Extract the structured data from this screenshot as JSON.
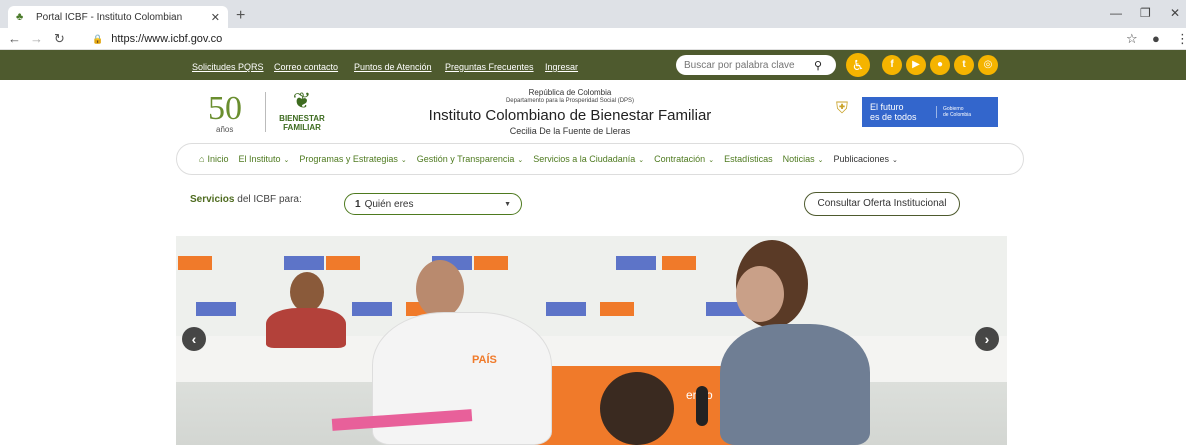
{
  "browser": {
    "tab_title": "Portal ICBF - Instituto Colombian",
    "url": "https://www.icbf.gov.co"
  },
  "topbar": {
    "links": [
      "Solicitudes PQRS",
      "Correo contacto",
      "Puntos de Atención",
      "Preguntas Frecuentes",
      "Ingresar"
    ],
    "search_placeholder": "Buscar por palabra clave"
  },
  "header": {
    "logo_number": "50",
    "logo_years": "años",
    "logo_bf_line1": "BIENESTAR",
    "logo_bf_line2": "FAMILIAR",
    "republic": "República de Colombia",
    "department": "Departamento para la Prosperidad Social (DPS)",
    "institute": "Instituto Colombiano de Bienestar Familiar",
    "director": "Cecilia De la Fuente de Lleras",
    "gov_slogan_1": "El futuro",
    "gov_slogan_2": "es de todos",
    "gov_name_1": "Gobierno",
    "gov_name_2": "de Colombia"
  },
  "nav": {
    "items": [
      "Inicio",
      "El Instituto",
      "Programas y Estrategias",
      "Gestión y Transparencia",
      "Servicios a la Ciudadanía",
      "Contratación",
      "Estadísticas",
      "Noticias",
      "Publicaciones"
    ]
  },
  "services": {
    "label_bold": "Servicios",
    "label_rest": " del ICBF para:",
    "select_number": "1",
    "select_value": "Quién eres",
    "consult_button": "Consultar Oferta Institucional"
  },
  "hero": {
    "shirt_text": "PAÍS",
    "banner_text": "endo"
  },
  "colors": {
    "topbar": "#4e5a2e",
    "accent_yellow": "#f5b400",
    "nav_green": "#4e7a1f",
    "gov_blue": "#3366cc"
  }
}
